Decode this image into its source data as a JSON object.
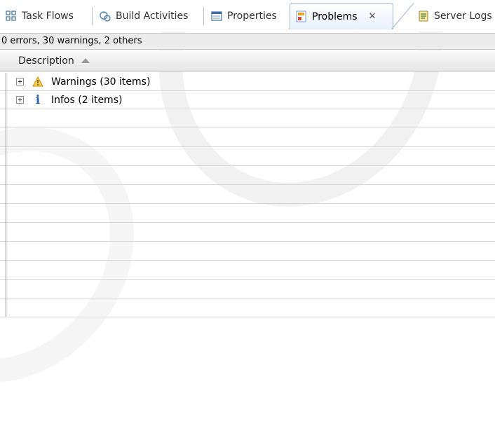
{
  "tabs": [
    {
      "label": "Task Flows",
      "icon": "task-flows-icon",
      "active": false
    },
    {
      "label": "Build Activities",
      "icon": "build-activities-icon",
      "active": false
    },
    {
      "label": "Properties",
      "icon": "properties-icon",
      "active": false
    },
    {
      "label": "Problems",
      "icon": "problems-icon",
      "active": true,
      "close": "✕"
    },
    {
      "label": "Server Logs",
      "icon": "server-logs-icon",
      "active": false
    }
  ],
  "summary": "0 errors, 30 warnings, 2 others",
  "column": {
    "label": "Description",
    "sort": "ascending"
  },
  "tree": [
    {
      "label": "Warnings (30 items)",
      "icon": "warning-icon"
    },
    {
      "label": "Infos (2 items)",
      "icon": "info-icon"
    }
  ],
  "colors": {
    "warning": "#e6b400",
    "info": "#2a5db0",
    "accent_border": "#9db2cc"
  }
}
